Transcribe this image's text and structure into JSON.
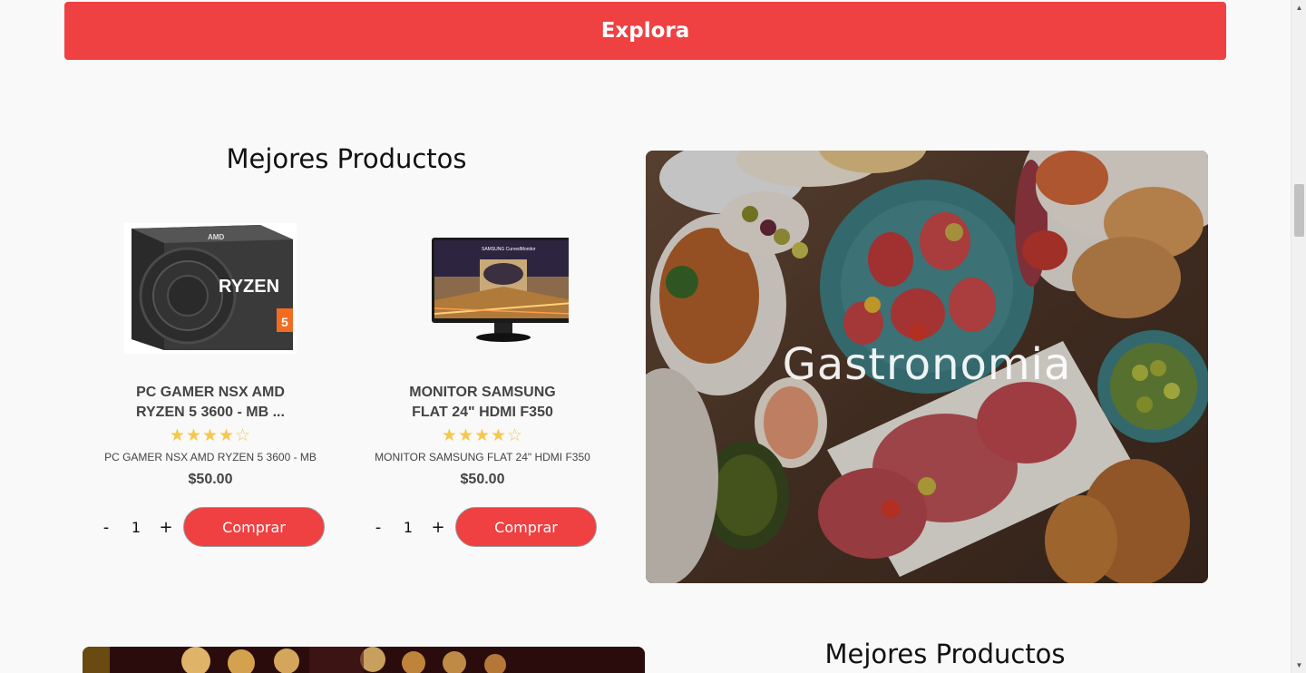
{
  "explore_button": "Explora",
  "section1": {
    "title": "Mejores Productos",
    "products": [
      {
        "name": "PC GAMER NSX AMD RYZEN 5 3600 - MB ...",
        "description": "PC GAMER NSX AMD RYZEN 5 3600 - MB",
        "price": "$50.00",
        "rating": 4,
        "stars": "★★★★☆",
        "qty": "1",
        "minus": "-",
        "plus": "+",
        "buy_label": "Comprar",
        "image": "amd-ryzen-box",
        "image_text": "RYZEN",
        "image_brand": "AMD",
        "image_num": "5"
      },
      {
        "name": "MONITOR SAMSUNG FLAT 24\" HDMI F350",
        "description": "MONITOR SAMSUNG FLAT 24\" HDMI F350",
        "price": "$50.00",
        "rating": 4,
        "stars": "★★★★☆",
        "qty": "1",
        "minus": "-",
        "plus": "+",
        "buy_label": "Comprar",
        "image": "samsung-monitor",
        "image_text": "SAMSUNG  CurvedMonitor"
      }
    ]
  },
  "category_card": {
    "label": "Gastronomia",
    "image": "food-platter-photo"
  },
  "section2": {
    "title": "Mejores Productos",
    "image": "concert-lights-photo"
  },
  "colors": {
    "accent": "#ef4042",
    "star": "#f5c84c",
    "background": "#f9f9f9"
  }
}
